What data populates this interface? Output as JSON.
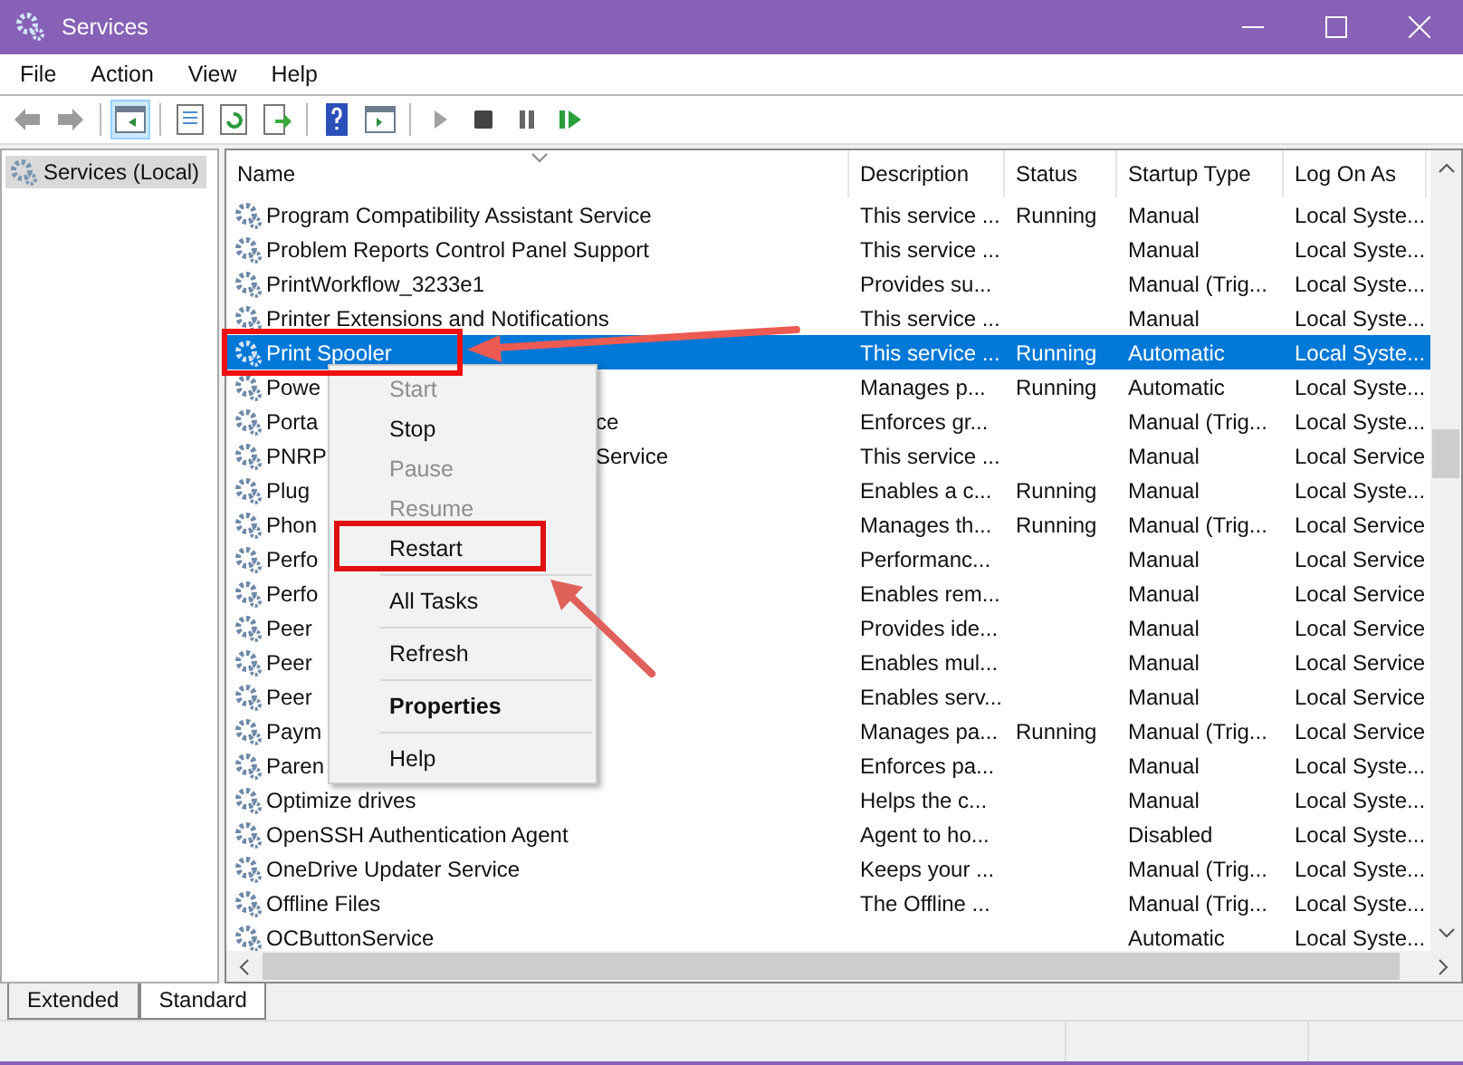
{
  "window": {
    "title": "Services"
  },
  "menu": [
    "File",
    "Action",
    "View",
    "Help"
  ],
  "toolbar": [
    {
      "kind": "back",
      "disabled": true,
      "selected": false
    },
    {
      "kind": "forward",
      "disabled": true,
      "selected": false
    },
    {
      "kind": "separator"
    },
    {
      "kind": "tree",
      "selected": true
    },
    {
      "kind": "separator"
    },
    {
      "kind": "properties",
      "selected": false
    },
    {
      "kind": "refresh",
      "selected": false
    },
    {
      "kind": "export",
      "selected": false
    },
    {
      "kind": "separator"
    },
    {
      "kind": "help",
      "selected": false
    },
    {
      "kind": "panel",
      "selected": false
    },
    {
      "kind": "separator"
    },
    {
      "kind": "play",
      "disabled": true,
      "selected": false
    },
    {
      "kind": "stop",
      "disabled": false,
      "selected": false
    },
    {
      "kind": "pause",
      "disabled": false,
      "selected": false
    },
    {
      "kind": "resume",
      "disabled": false,
      "selected": false
    }
  ],
  "tree": [
    {
      "label": "Services (Local)",
      "selected": true
    }
  ],
  "table": {
    "columns": [
      "Name",
      "Description",
      "Status",
      "Startup Type",
      "Log On As"
    ],
    "rows": [
      {
        "name": "Program Compatibility Assistant Service",
        "description": "This service ...",
        "status": "Running",
        "startup": "Manual",
        "logon": "Local Syste...",
        "selected": false
      },
      {
        "name": "Problem Reports Control Panel Support",
        "description": "This service ...",
        "startup": "Manual",
        "logon": "Local Syste...",
        "selected": false
      },
      {
        "name": "PrintWorkflow_3233e1",
        "description": "Provides su...",
        "startup": "Manual (Trig...",
        "logon": "Local Syste...",
        "selected": false
      },
      {
        "name": "Printer Extensions and Notifications",
        "description": "This service ...",
        "startup": "Manual",
        "logon": "Local Syste...",
        "selected": false
      },
      {
        "name": "Print Spooler",
        "description": "This service ...",
        "status": "Running",
        "startup": "Automatic",
        "logon": "Local Syste...",
        "selected": true
      },
      {
        "name": "Powe",
        "description": "Manages p...",
        "status": "Running",
        "startup": "Automatic",
        "logon": "Local Syste...",
        "selected": false
      },
      {
        "name": "Porta",
        "name_tail": "ce",
        "description": "Enforces gr...",
        "startup": "Manual (Trig...",
        "logon": "Local Syste...",
        "selected": false
      },
      {
        "name": "PNRP",
        "name_tail": "Service",
        "description": "This service ...",
        "startup": "Manual",
        "logon": "Local Service",
        "selected": false
      },
      {
        "name": "Plug",
        "description": "Enables a c...",
        "status": "Running",
        "startup": "Manual",
        "logon": "Local Syste...",
        "selected": false
      },
      {
        "name": "Phon",
        "description": "Manages th...",
        "status": "Running",
        "startup": "Manual (Trig...",
        "logon": "Local Service",
        "selected": false
      },
      {
        "name": "Perfo",
        "description": "Performanc...",
        "startup": "Manual",
        "logon": "Local Service",
        "selected": false
      },
      {
        "name": "Perfo",
        "description": "Enables rem...",
        "startup": "Manual",
        "logon": "Local Service",
        "selected": false
      },
      {
        "name": "Peer",
        "description": "Provides ide...",
        "startup": "Manual",
        "logon": "Local Service",
        "selected": false
      },
      {
        "name": "Peer",
        "description": "Enables mul...",
        "startup": "Manual",
        "logon": "Local Service",
        "selected": false
      },
      {
        "name": "Peer",
        "description": "Enables serv...",
        "startup": "Manual",
        "logon": "Local Service",
        "selected": false
      },
      {
        "name": "Paym",
        "description": "Manages pa...",
        "status": "Running",
        "startup": "Manual (Trig...",
        "logon": "Local Service",
        "selected": false
      },
      {
        "name": "Paren",
        "description": "Enforces pa...",
        "startup": "Manual",
        "logon": "Local Syste...",
        "selected": false
      },
      {
        "name": "Optimize drives",
        "description": "Helps the c...",
        "startup": "Manual",
        "logon": "Local Syste...",
        "selected": false
      },
      {
        "name": "OpenSSH Authentication Agent",
        "description": "Agent to ho...",
        "startup": "Disabled",
        "logon": "Local Syste...",
        "selected": false
      },
      {
        "name": "OneDrive Updater Service",
        "description": "Keeps your ...",
        "startup": "Manual (Trig...",
        "logon": "Local Syste...",
        "selected": false
      },
      {
        "name": "Offline Files",
        "description": "The Offline ...",
        "startup": "Manual (Trig...",
        "logon": "Local Syste...",
        "selected": false
      },
      {
        "name": "OCButtonService",
        "startup": "Automatic",
        "logon": "Local Syste...",
        "selected": false
      }
    ]
  },
  "context_menu": [
    {
      "kind": "item",
      "label": "Start",
      "disabled": true
    },
    {
      "kind": "item",
      "label": "Stop",
      "disabled": false
    },
    {
      "kind": "item",
      "label": "Pause",
      "disabled": true
    },
    {
      "kind": "item",
      "label": "Resume",
      "disabled": true
    },
    {
      "kind": "item",
      "label": "Restart",
      "disabled": false
    },
    {
      "kind": "separator"
    },
    {
      "kind": "item",
      "label": "All Tasks",
      "disabled": false
    },
    {
      "kind": "separator"
    },
    {
      "kind": "item",
      "label": "Refresh",
      "disabled": false
    },
    {
      "kind": "separator"
    },
    {
      "kind": "default",
      "label": "Properties",
      "disabled": false
    },
    {
      "kind": "separator"
    },
    {
      "kind": "item",
      "label": "Help",
      "disabled": false
    }
  ],
  "view_tabs": [
    {
      "label": "Extended",
      "selected": false
    },
    {
      "label": "Standard",
      "selected": true
    }
  ]
}
